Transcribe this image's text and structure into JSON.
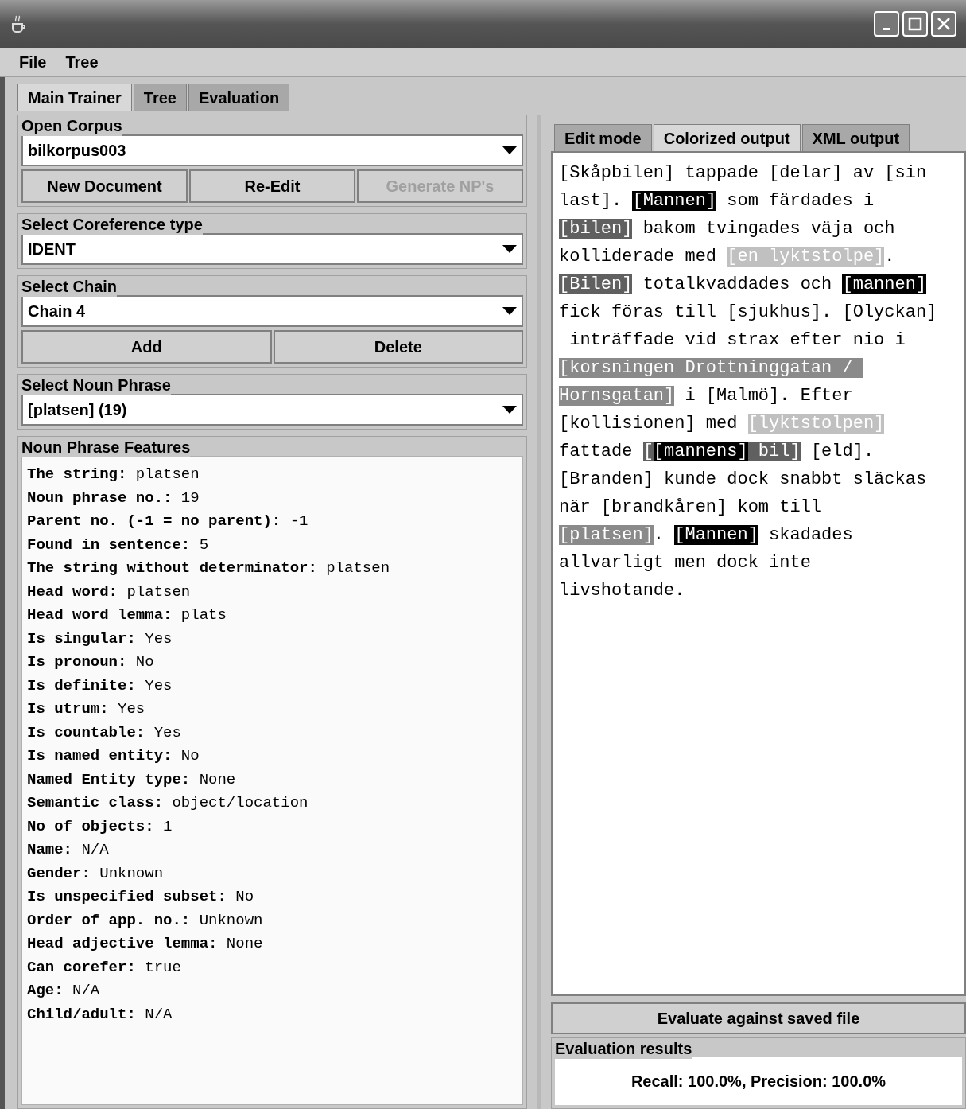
{
  "menu": [
    "File",
    "Tree"
  ],
  "main_tabs": [
    {
      "label": "Main Trainer",
      "selected": true
    },
    {
      "label": "Tree",
      "selected": false
    },
    {
      "label": "Evaluation",
      "selected": false
    }
  ],
  "open_corpus": {
    "title": "Open Corpus",
    "value": "bilkorpus003"
  },
  "document_buttons": [
    {
      "label": "New Document",
      "disabled": false
    },
    {
      "label": "Re-Edit",
      "disabled": false
    },
    {
      "label": "Generate NP's",
      "disabled": true
    }
  ],
  "coreference_type": {
    "title": "Select Coreference type",
    "value": "IDENT"
  },
  "chain": {
    "title": "Select Chain",
    "value": "Chain 4"
  },
  "chain_buttons": [
    {
      "label": "Add",
      "disabled": false
    },
    {
      "label": "Delete",
      "disabled": false
    }
  ],
  "noun_phrase": {
    "title": "Select Noun Phrase",
    "value": "[platsen] (19)"
  },
  "features": {
    "title": "Noun Phrase Features",
    "items": [
      {
        "label": "The string:",
        "value": "platsen"
      },
      {
        "label": "Noun phrase no.:",
        "value": "19"
      },
      {
        "label": "Parent no. (-1 = no parent):",
        "value": "-1"
      },
      {
        "label": "Found in sentence:",
        "value": "5"
      },
      {
        "label": "The string without determinator:",
        "value": "platsen"
      },
      {
        "label": "Head word:",
        "value": "platsen"
      },
      {
        "label": "Head word lemma:",
        "value": "plats"
      },
      {
        "label": "Is singular:",
        "value": "Yes"
      },
      {
        "label": "Is pronoun:",
        "value": "No"
      },
      {
        "label": "Is definite:",
        "value": "Yes"
      },
      {
        "label": "Is utrum:",
        "value": "Yes"
      },
      {
        "label": "Is countable:",
        "value": "Yes"
      },
      {
        "label": "Is named entity:",
        "value": "No"
      },
      {
        "label": "Named Entity type:",
        "value": "None"
      },
      {
        "label": "Semantic class:",
        "value": "object/location"
      },
      {
        "label": "No of objects:",
        "value": "1"
      },
      {
        "label": "Name:",
        "value": "N/A"
      },
      {
        "label": "Gender:",
        "value": "Unknown"
      },
      {
        "label": "Is unspecified subset:",
        "value": "No"
      },
      {
        "label": "Order of app. no.:",
        "value": "Unknown"
      },
      {
        "label": "Head adjective lemma:",
        "value": "None"
      },
      {
        "label": "Can corefer:",
        "value": "true"
      },
      {
        "label": "Age:",
        "value": "N/A"
      },
      {
        "label": "Child/adult:",
        "value": "N/A"
      }
    ]
  },
  "output_tabs": [
    {
      "label": "Edit mode",
      "selected": false
    },
    {
      "label": "Colorized output",
      "selected": true
    },
    {
      "label": "XML output",
      "selected": false
    }
  ],
  "colorized_text": [
    [
      {
        "text": "[Skåpbilen] tappade [delar] av [sin"
      }
    ],
    [
      {
        "text": "last]. "
      },
      {
        "text": "[Mannen]",
        "color": "#000000"
      },
      {
        "text": " som färdades i"
      }
    ],
    [
      {
        "text": "[bilen]",
        "color": "#606060"
      },
      {
        "text": " bakom tvingades väja och"
      }
    ],
    [
      {
        "text": "kolliderade med "
      },
      {
        "text": "[en lyktstolpe]",
        "color": "#c0c0c0"
      },
      {
        "text": "."
      }
    ],
    [
      {
        "text": "[Bilen]",
        "color": "#606060"
      },
      {
        "text": " totalkvaddades och "
      },
      {
        "text": "[mannen]",
        "color": "#000000"
      }
    ],
    [
      {
        "text": "fick föras till [sjukhus]. [Olyckan]"
      }
    ],
    [
      {
        "text": " inträffade vid strax efter nio i"
      }
    ],
    [
      {
        "text": "[korsningen Drottninggatan / ",
        "color": "#8a8a8a"
      }
    ],
    [
      {
        "text": "Hornsgatan]",
        "color": "#8a8a8a"
      },
      {
        "text": " i [Malmö]. Efter"
      }
    ],
    [
      {
        "text": "[kollisionen] med "
      },
      {
        "text": "[lyktstolpen]",
        "color": "#c0c0c0"
      }
    ],
    [
      {
        "text": "fattade "
      },
      {
        "text": "[",
        "color": "#606060"
      },
      {
        "text": "[mannens]",
        "color": "#000000"
      },
      {
        "text": " bil]",
        "color": "#606060"
      },
      {
        "text": " [eld]."
      }
    ],
    [
      {
        "text": "[Branden] kunde dock snabbt släckas"
      }
    ],
    [
      {
        "text": "när [brandkåren] kom till"
      }
    ],
    [
      {
        "text": "[platsen]",
        "color": "#8a8a8a"
      },
      {
        "text": ". "
      },
      {
        "text": "[Mannen]",
        "color": "#000000"
      },
      {
        "text": " skadades"
      }
    ],
    [
      {
        "text": "allvarligt men dock inte"
      }
    ],
    [
      {
        "text": "livshotande."
      }
    ]
  ],
  "evaluate_button": "Evaluate against saved file",
  "evaluation_results": {
    "title": "Evaluation results",
    "text": "Recall: 100.0%, Precision: 100.0%"
  }
}
